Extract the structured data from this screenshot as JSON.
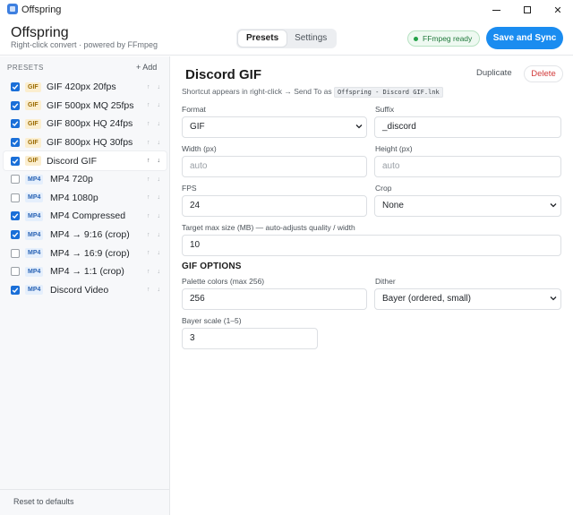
{
  "window": {
    "title": "Offspring"
  },
  "header": {
    "app_name": "Offspring",
    "subtitle": "Right-click convert · powered by FFmpeg",
    "tabs": [
      {
        "label": "Presets",
        "active": true
      },
      {
        "label": "Settings",
        "active": false
      }
    ],
    "status": "FFmpeg ready",
    "save_label": "Save and Sync"
  },
  "sidebar": {
    "heading": "PRESETS",
    "add_label": "+ Add",
    "reset_label": "Reset to defaults",
    "items": [
      {
        "badge": "GIF",
        "name": "GIF 420px 20fps",
        "checked": true
      },
      {
        "badge": "GIF",
        "name": "GIF 500px MQ 25fps",
        "checked": true
      },
      {
        "badge": "GIF",
        "name": "GIF 800px HQ 24fps",
        "checked": true
      },
      {
        "badge": "GIF",
        "name": "GIF 800px HQ 30fps",
        "checked": true
      },
      {
        "badge": "GIF",
        "name": "Discord GIF",
        "checked": true,
        "selected": true
      },
      {
        "badge": "MP4",
        "name": "MP4 720p",
        "checked": false
      },
      {
        "badge": "MP4",
        "name": "MP4 1080p",
        "checked": false
      },
      {
        "badge": "MP4",
        "name": "MP4 Compressed",
        "checked": true
      },
      {
        "badge": "MP4",
        "name": "MP4 → 9:16 (crop)",
        "checked": true
      },
      {
        "badge": "MP4",
        "name": "MP4 → 16:9 (crop)",
        "checked": false
      },
      {
        "badge": "MP4",
        "name": "MP4 → 1:1 (crop)",
        "checked": false
      },
      {
        "badge": "MP4",
        "name": "Discord Video",
        "checked": true
      }
    ],
    "arrows": "↑ ↓"
  },
  "main": {
    "title": "Discord GIF",
    "duplicate_label": "Duplicate",
    "delete_label": "Delete",
    "shortcut_text": "Shortcut appears in right-click → Send To as",
    "shortcut_code": "Offspring - Discord GIF.lnk",
    "format": {
      "label": "Format",
      "value": "GIF"
    },
    "suffix": {
      "label": "Suffix",
      "value": "_discord"
    },
    "width": {
      "label": "Width (px)",
      "placeholder": "auto"
    },
    "height": {
      "label": "Height (px)",
      "placeholder": "auto"
    },
    "fps": {
      "label": "FPS",
      "value": "24"
    },
    "crop": {
      "label": "Crop",
      "value": "None"
    },
    "target": {
      "label": "Target max size (MB) — auto-adjusts quality / width",
      "value": "10"
    },
    "gif_options_title": "GIF OPTIONS",
    "palette": {
      "label": "Palette colors (max 256)",
      "value": "256"
    },
    "dither": {
      "label": "Dither",
      "value": "Bayer (ordered, small)"
    },
    "bayer": {
      "label": "Bayer scale (1–5)",
      "value": "3"
    }
  },
  "colors": {
    "accent": "#1a8cf0",
    "checkbox": "#1a6fd8",
    "delete": "#d23b3b",
    "ready": "#24a148"
  }
}
